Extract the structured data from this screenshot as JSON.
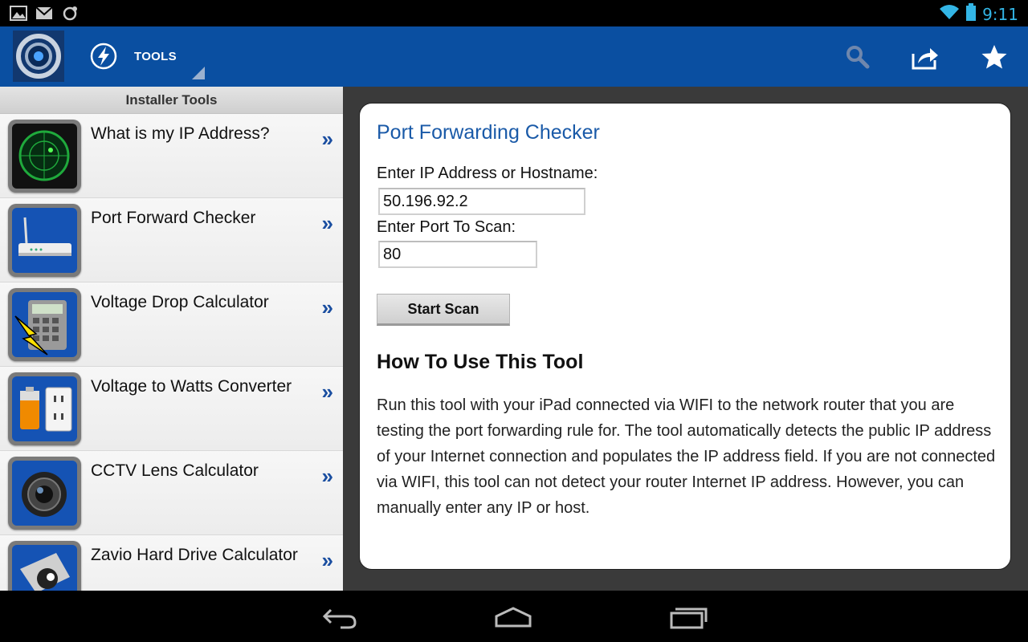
{
  "status": {
    "time": "9:11"
  },
  "actionbar": {
    "title": "TOOLS"
  },
  "sidebar": {
    "header": "Installer Tools",
    "items": [
      {
        "label": "What is my IP Address?"
      },
      {
        "label": "Port Forward Checker"
      },
      {
        "label": "Voltage Drop Calculator"
      },
      {
        "label": "Voltage to Watts Converter"
      },
      {
        "label": "CCTV Lens Calculator"
      },
      {
        "label": "Zavio Hard Drive Calculator"
      }
    ],
    "chevron": "»"
  },
  "main": {
    "title": "Port Forwarding Checker",
    "ip_label": "Enter IP Address or Hostname:",
    "ip_value": "50.196.92.2",
    "port_label": "Enter Port To Scan:",
    "port_value": "80",
    "scan_button": "Start Scan",
    "howto_title": "How To Use This Tool",
    "howto_text": "Run this tool with your iPad connected via WIFI to the network router that you are testing the port forwarding rule for. The tool automatically detects the public IP address of your Internet connection and populates the IP address field. If you are not connected via WIFI, this tool can not detect your router Internet IP address. However, you can manually enter any IP or host."
  }
}
